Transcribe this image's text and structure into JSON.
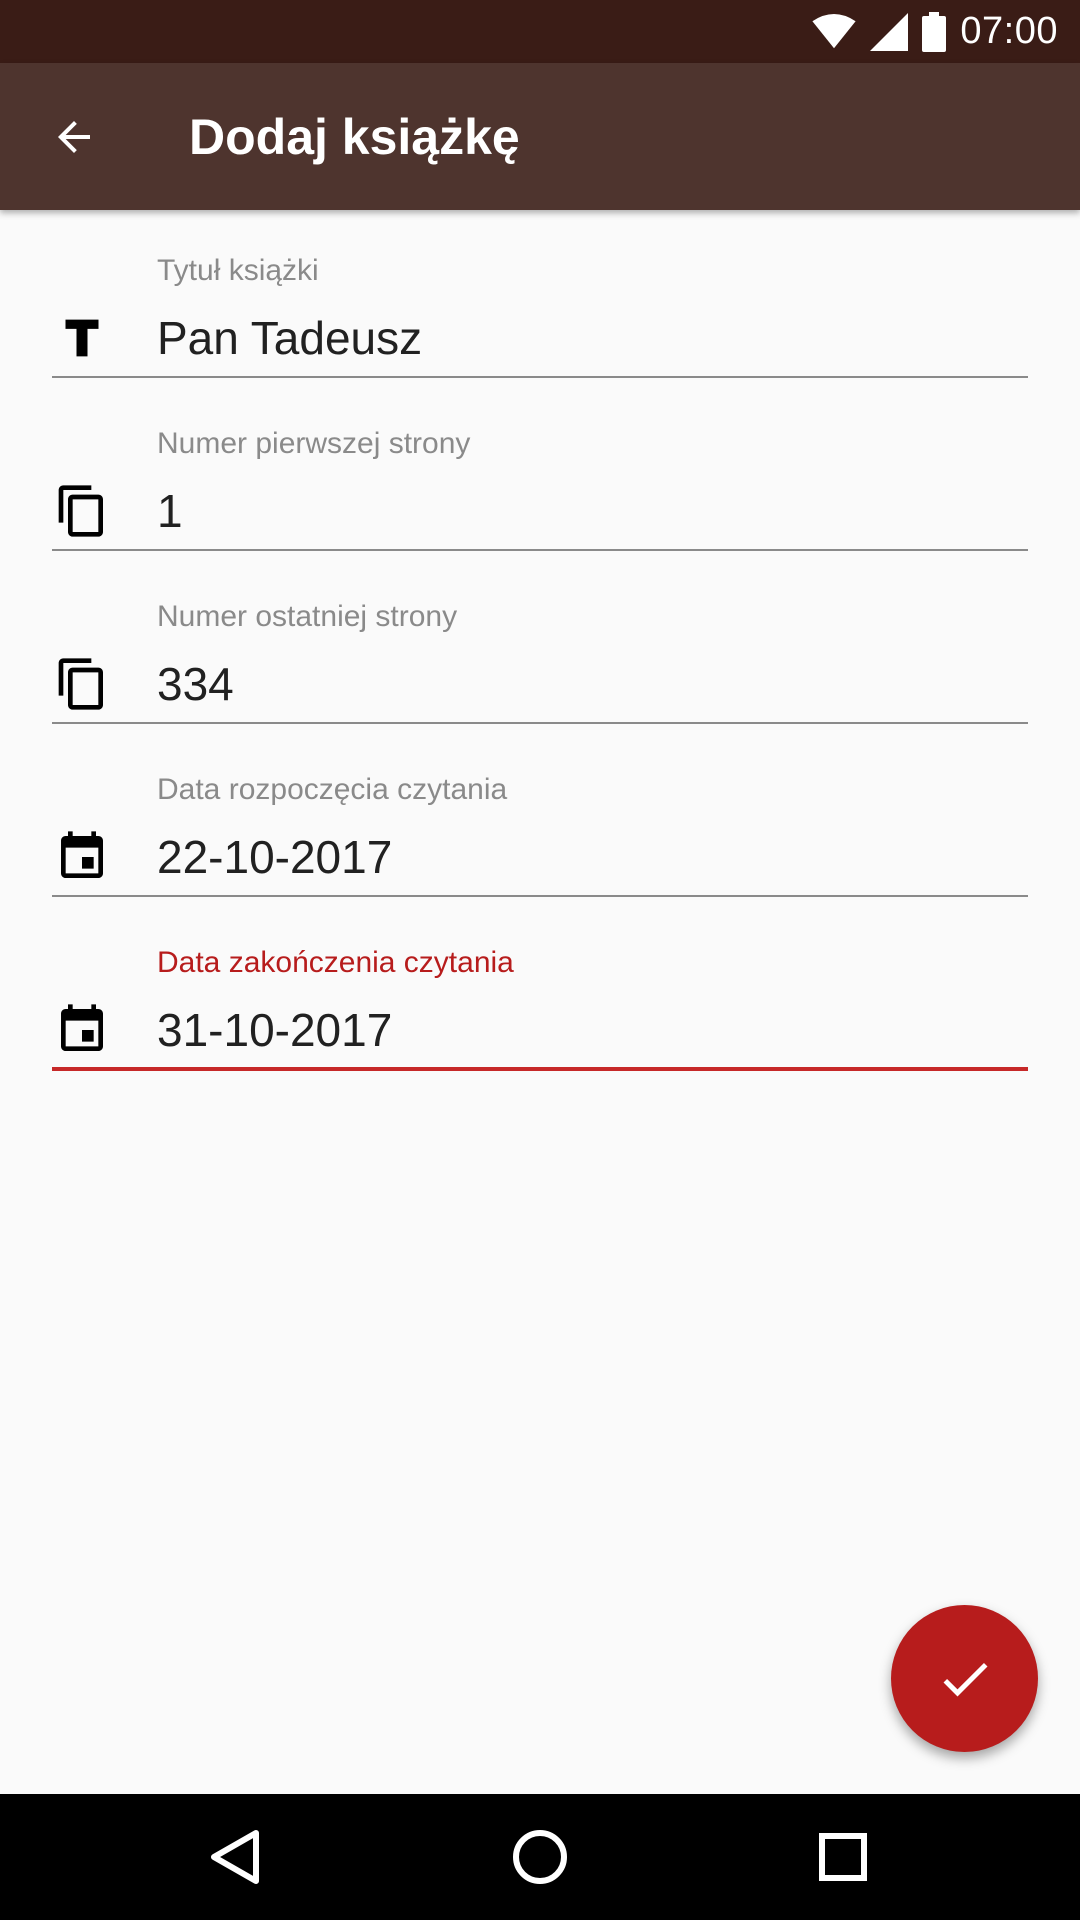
{
  "status_bar": {
    "time": "07:00",
    "icons": [
      "wifi-icon",
      "signal-icon",
      "battery-icon"
    ]
  },
  "app_bar": {
    "title": "Dodaj książkę",
    "back_icon": "arrow-back-icon"
  },
  "form": {
    "fields": [
      {
        "label": "Tytuł książki",
        "value": "Pan Tadeusz",
        "icon": "title-text-icon",
        "active": false
      },
      {
        "label": "Numer pierwszej strony",
        "value": "1",
        "icon": "copy-pages-icon",
        "active": false
      },
      {
        "label": "Numer ostatniej strony",
        "value": "334",
        "icon": "copy-pages-icon",
        "active": false
      },
      {
        "label": "Data rozpoczęcia czytania",
        "value": "22-10-2017",
        "icon": "calendar-icon",
        "active": false
      },
      {
        "label": "Data zakończenia czytania",
        "value": "31-10-2017",
        "icon": "calendar-icon",
        "active": true
      }
    ]
  },
  "fab": {
    "icon": "check-icon"
  },
  "nav_bar": {
    "icons": [
      "back-triangle-icon",
      "home-circle-icon",
      "recents-square-icon"
    ]
  },
  "colors": {
    "status_bar": "#3a1c16",
    "app_bar": "#4e342e",
    "accent": "#b71c1c",
    "background": "#fafafa"
  }
}
